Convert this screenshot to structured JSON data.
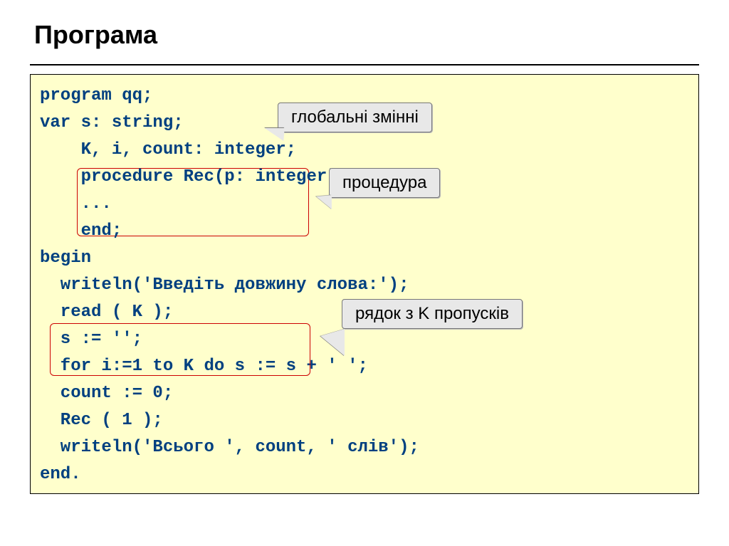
{
  "title": "Програма",
  "code": {
    "l1": "program qq;",
    "l2": "var s: string;",
    "l3": "    K, i, count: integer;",
    "l4": "    procedure Rec(p: integer);",
    "l5": "    ...",
    "l6": "    end;",
    "l7": "begin",
    "l8": "  writeln('Введіть довжину слова:');",
    "l9": "  read ( K );",
    "l10": "  s := '';",
    "l11": "  for i:=1 to K do s := s + ' ';",
    "l12": "  count := 0;",
    "l13": "  Rec ( 1 );",
    "l14": "  writeln('Всього ', count, ' слів');",
    "l15": "end."
  },
  "callouts": {
    "globals": "глобальні змінні",
    "procedure": "процедура",
    "loop": "рядок з K пропусків"
  }
}
